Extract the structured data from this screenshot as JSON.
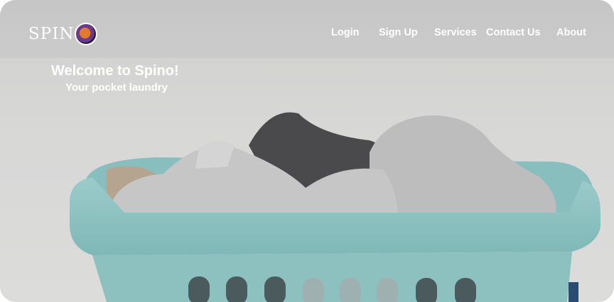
{
  "brand": {
    "name": "SPIN",
    "logo_icon": "spino-logo-icon"
  },
  "nav": {
    "login": "Login",
    "signup": "Sign Up",
    "services": "Services",
    "contact": "Contact Us",
    "about": "About"
  },
  "hero": {
    "title": "Welcome to Spino!",
    "subtitle": "Your pocket laundry"
  },
  "colors": {
    "basket": "#8fc3c2",
    "basket_dark": "#6ea9a8",
    "wall": "#d8d8d7"
  }
}
